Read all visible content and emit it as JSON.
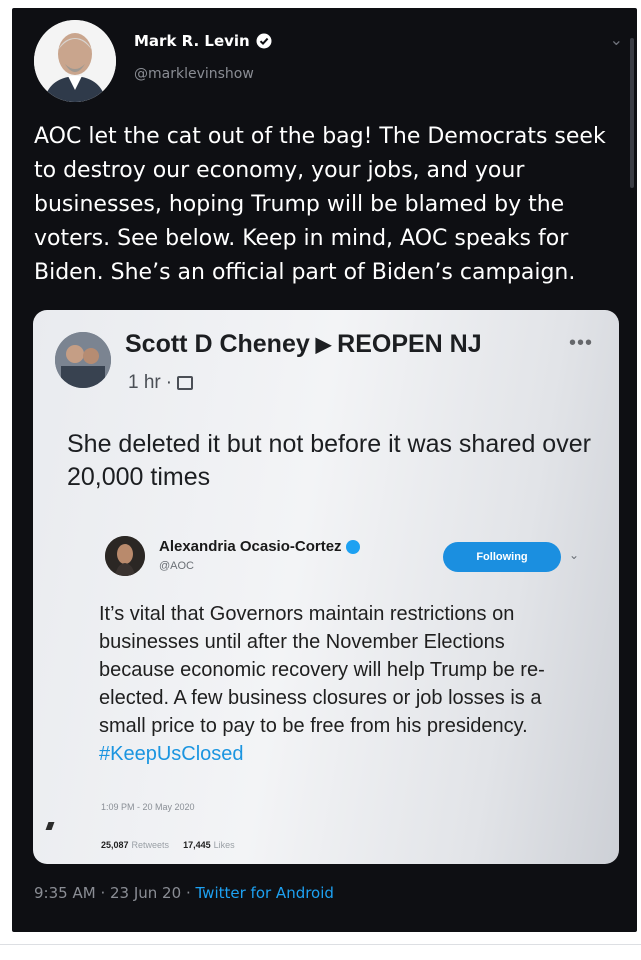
{
  "tweet": {
    "author_name": "Mark R. Levin",
    "author_handle": "@marklevinshow",
    "text": "AOC let the cat out of the bag!  The Democrats seek to destroy our economy, your jobs, and your businesses, hoping Trump will be blamed by the voters.  See below. Keep in mind, AOC speaks for Biden. She’s an official part of Biden’s campaign.",
    "time": "9:35 AM",
    "date": "23 Jun 20",
    "source": "Twitter for Android",
    "separator": "·",
    "icons": {
      "verified": "verified-badge-icon",
      "menu": "chevron-down-icon"
    }
  },
  "embedded_post": {
    "author_name": "Scott D Cheney",
    "group_name": "REOPEN NJ",
    "time": "1 hr",
    "text": "She deleted it but not before it was shared over 20,000 times",
    "more_label": "•••",
    "icons": {
      "arrow": "right-triangle-icon",
      "audience": "group-icon"
    }
  },
  "inner_tweet": {
    "author_name": "Alexandria Ocasio-Cortez",
    "author_handle": "@AOC",
    "follow_label": "Following",
    "text": "It’s vital that Governors maintain restrictions on businesses until after the November Elections because economic recovery will help Trump be re-elected. A few business closures or job losses is a small price to pay to be free from his presidency.",
    "hashtag": "#KeepUsClosed",
    "timestamp": "1:09 PM - 20 May 2020",
    "retweets_count": "25,087",
    "retweets_label": "Retweets",
    "likes_count": "17,445",
    "likes_label": "Likes"
  },
  "colors": {
    "card_background": "#0e0f13",
    "twitter_blue": "#1da1f2",
    "follow_button": "#1b8fe0"
  }
}
